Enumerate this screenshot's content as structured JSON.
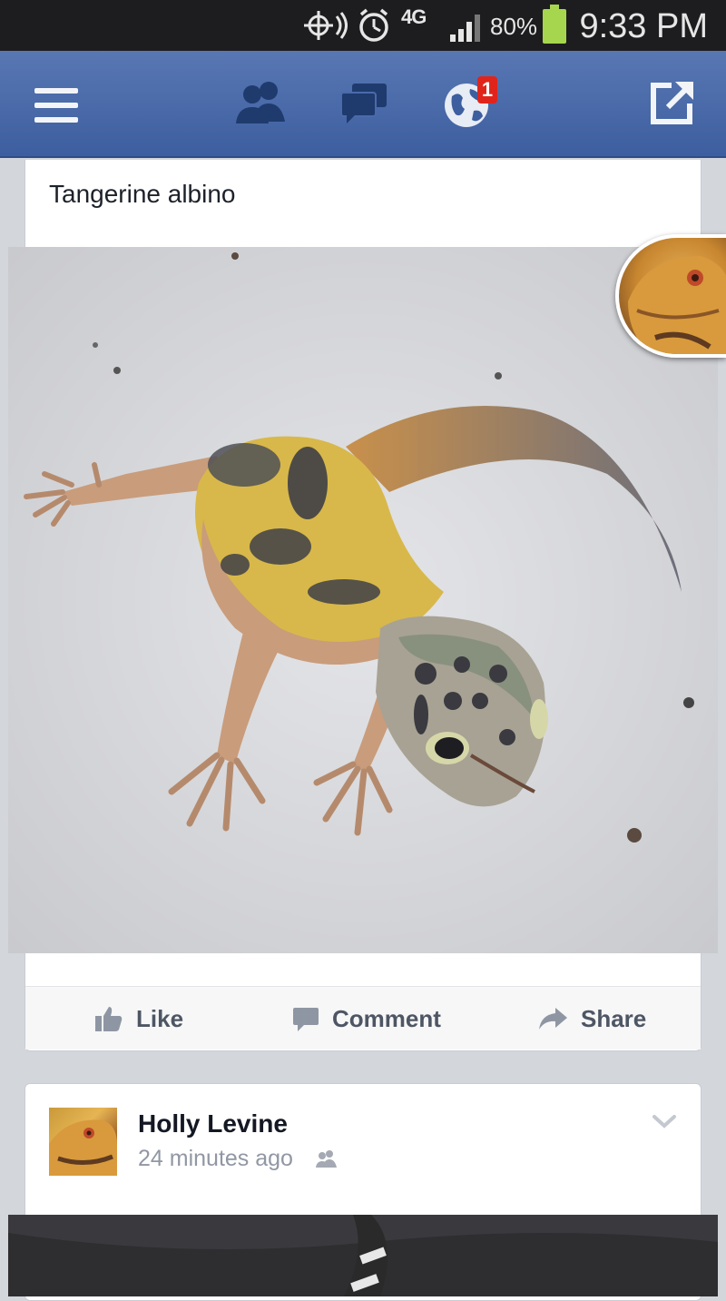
{
  "status_bar": {
    "network": "4G",
    "battery_percent": "80%",
    "time": "9:33 PM"
  },
  "navbar": {
    "notification_count": "1",
    "icons": [
      "menu-icon",
      "friends-icon",
      "messages-icon",
      "globe-notifications-icon",
      "share-out-icon"
    ]
  },
  "post1": {
    "text": "Tangerine albino",
    "photo": "leopard-gecko-photo",
    "actions": {
      "like": "Like",
      "comment": "Comment",
      "share": "Share"
    }
  },
  "post2": {
    "author": "Holly Levine",
    "time": "24 minutes ago",
    "photo": "gecko-photo-partial"
  },
  "colors": {
    "nav_blue": "#3d5e9f",
    "badge_red": "#e0241b",
    "text_dark": "#141823",
    "text_muted": "#9197a3",
    "battery_green": "#a6d64d"
  }
}
